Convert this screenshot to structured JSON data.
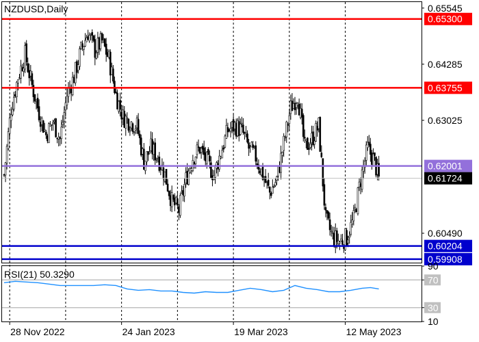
{
  "chart_title": "NZDUSD,Daily",
  "indicator_label": "RSI(21) 50.3290",
  "colors": {
    "resistance": "#ff0000",
    "pivot": "#9370db",
    "support": "#0000cd",
    "rsi_line": "#1e90ff",
    "candle_up": "#ffffff",
    "candle_down": "#000000",
    "current_label_bg": "#000000"
  },
  "chart_data": {
    "type": "candlestick",
    "title": "NZDUSD,Daily",
    "price_axis_ticks": [
      0.65545,
      0.64285,
      0.63025,
      0.6049
    ],
    "ylim": [
      0.5983,
      0.6568
    ],
    "x_tick_labels": [
      "28 Nov 2022",
      "24 Jan 2023",
      "19 Mar 2023",
      "12 May 2023"
    ],
    "horizontal_levels": [
      {
        "value": 0.653,
        "label": "0.65300",
        "role": "resistance"
      },
      {
        "value": 0.63755,
        "label": "0.63755",
        "role": "resistance"
      },
      {
        "value": 0.62001,
        "label": "0.62001",
        "role": "pivot"
      },
      {
        "value": 0.60204,
        "label": "0.60204",
        "role": "support"
      },
      {
        "value": 0.59908,
        "label": "0.59908",
        "role": "support"
      }
    ],
    "current_price": {
      "value": 0.61724,
      "label": "0.61724"
    },
    "close_path": [
      [
        0,
        0.618
      ],
      [
        5,
        0.633
      ],
      [
        10,
        0.64
      ],
      [
        15,
        0.645
      ],
      [
        20,
        0.638
      ],
      [
        25,
        0.632
      ],
      [
        30,
        0.627
      ],
      [
        35,
        0.63
      ],
      [
        40,
        0.626
      ],
      [
        45,
        0.636
      ],
      [
        50,
        0.64
      ],
      [
        55,
        0.646
      ],
      [
        60,
        0.65
      ],
      [
        65,
        0.646
      ],
      [
        70,
        0.648
      ],
      [
        75,
        0.644
      ],
      [
        80,
        0.636
      ],
      [
        85,
        0.631
      ],
      [
        90,
        0.63
      ],
      [
        95,
        0.629
      ],
      [
        100,
        0.621
      ],
      [
        105,
        0.624
      ],
      [
        110,
        0.622
      ],
      [
        115,
        0.618
      ],
      [
        120,
        0.612
      ],
      [
        125,
        0.61
      ],
      [
        130,
        0.617
      ],
      [
        135,
        0.622
      ],
      [
        140,
        0.624
      ],
      [
        145,
        0.621
      ],
      [
        150,
        0.618
      ],
      [
        155,
        0.623
      ],
      [
        160,
        0.628
      ],
      [
        165,
        0.629
      ],
      [
        170,
        0.628
      ],
      [
        175,
        0.624
      ],
      [
        180,
        0.622
      ],
      [
        185,
        0.618
      ],
      [
        190,
        0.614
      ],
      [
        195,
        0.617
      ],
      [
        200,
        0.625
      ],
      [
        205,
        0.633
      ],
      [
        210,
        0.636
      ],
      [
        215,
        0.624
      ],
      [
        220,
        0.626
      ],
      [
        225,
        0.629
      ],
      [
        230,
        0.608
      ],
      [
        235,
        0.604
      ],
      [
        240,
        0.603
      ],
      [
        245,
        0.604
      ],
      [
        250,
        0.608
      ],
      [
        255,
        0.617
      ],
      [
        260,
        0.624
      ],
      [
        265,
        0.621
      ],
      [
        268,
        0.617
      ]
    ],
    "indicator": {
      "name": "RSI(21)",
      "last_value": 50.329,
      "scale_ticks": [
        90,
        70,
        30,
        10
      ],
      "ylim": [
        10,
        90
      ],
      "levels": [
        70,
        30
      ],
      "values": [
        [
          0,
          66
        ],
        [
          8,
          68
        ],
        [
          16,
          67
        ],
        [
          24,
          66
        ],
        [
          32,
          64
        ],
        [
          40,
          62
        ],
        [
          48,
          62
        ],
        [
          56,
          62
        ],
        [
          64,
          62
        ],
        [
          72,
          63
        ],
        [
          80,
          62
        ],
        [
          88,
          57
        ],
        [
          96,
          55
        ],
        [
          104,
          56
        ],
        [
          112,
          54
        ],
        [
          120,
          54
        ],
        [
          128,
          52
        ],
        [
          136,
          51
        ],
        [
          144,
          53
        ],
        [
          152,
          52
        ],
        [
          160,
          52
        ],
        [
          168,
          55
        ],
        [
          176,
          58
        ],
        [
          184,
          56
        ],
        [
          192,
          53
        ],
        [
          200,
          55
        ],
        [
          208,
          62
        ],
        [
          216,
          58
        ],
        [
          224,
          56
        ],
        [
          232,
          53
        ],
        [
          240,
          53
        ],
        [
          248,
          55
        ],
        [
          256,
          58
        ],
        [
          262,
          59
        ],
        [
          268,
          57
        ]
      ]
    }
  }
}
